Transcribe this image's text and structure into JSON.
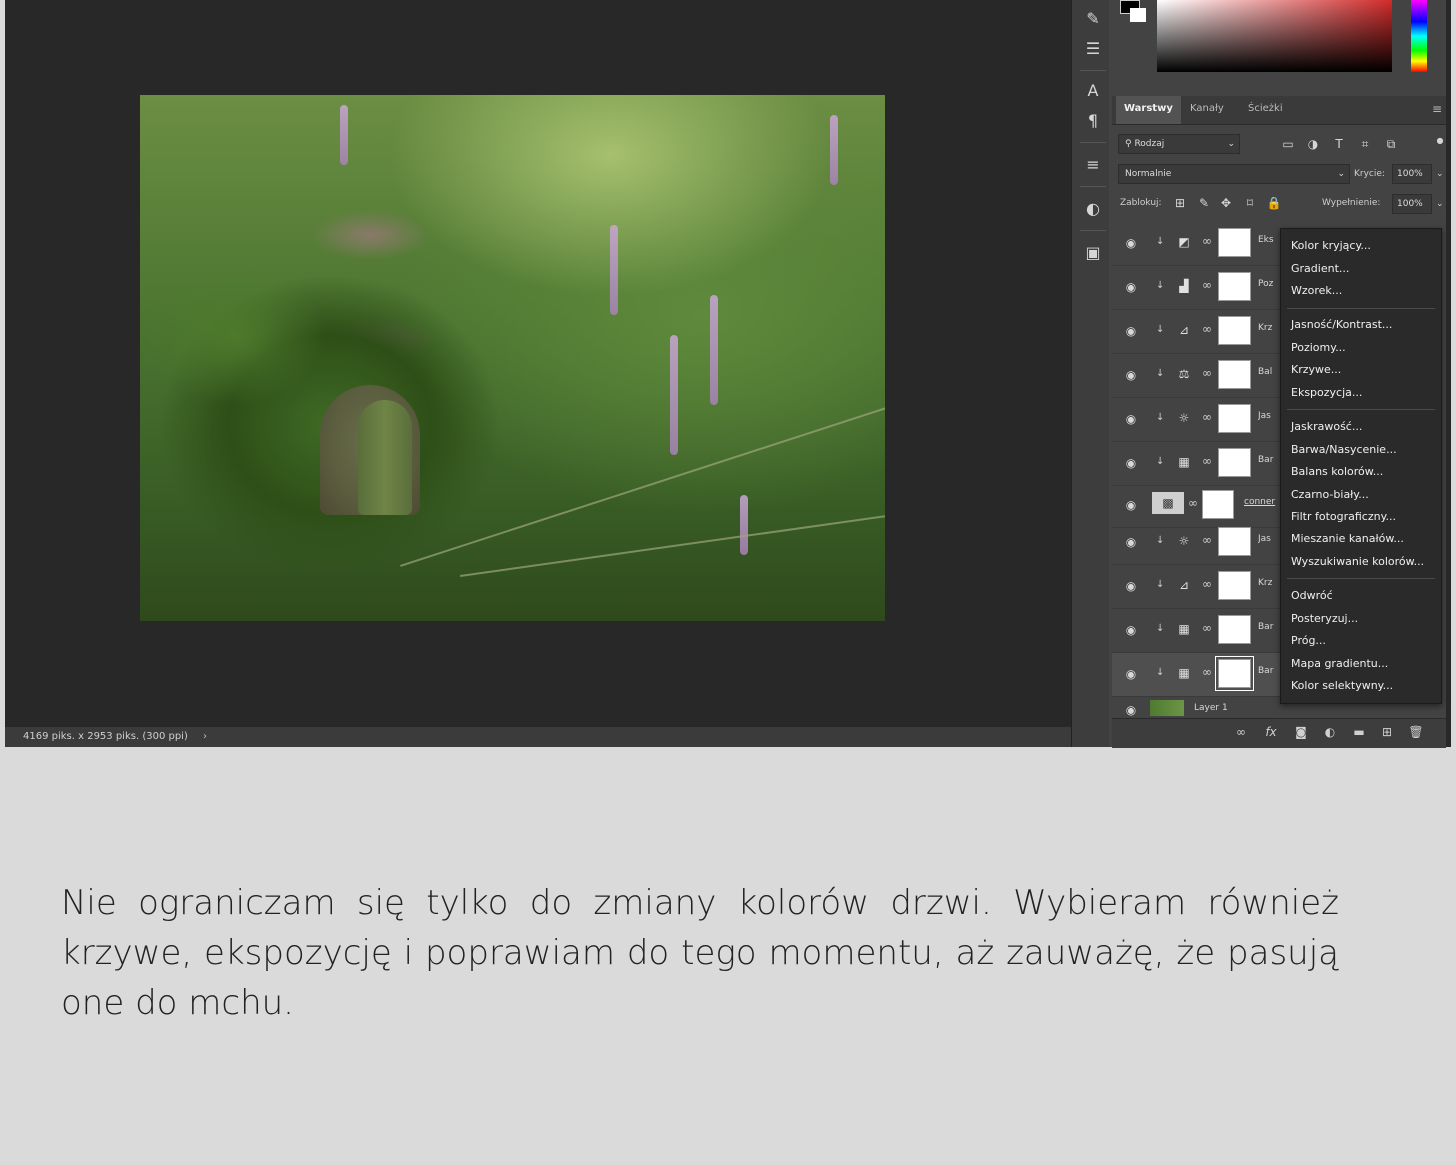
{
  "statusbar": {
    "dimensions": "4169 piks. x 2953 piks. (300 ppi)",
    "arrow": "›"
  },
  "panel": {
    "tabs": [
      "Warstwy",
      "Kanały",
      "Ścieżki"
    ],
    "filter": "Rodzaj",
    "blend_mode": "Normalnie",
    "opacity_label": "Krycie:",
    "opacity_value": "100%",
    "lock_label": "Zablokuj:",
    "fill_label": "Wypełnienie:",
    "fill_value": "100%"
  },
  "layers": [
    {
      "name": "Eks",
      "adj_icon": "exposure-icon"
    },
    {
      "name": "Poz",
      "adj_icon": "levels-icon"
    },
    {
      "name": "Krz",
      "adj_icon": "curves-icon"
    },
    {
      "name": "Bal",
      "adj_icon": "color-balance-icon"
    },
    {
      "name": "Jas",
      "adj_icon": "brightness-icon"
    },
    {
      "name": "Bar",
      "adj_icon": "hue-saturation-icon"
    },
    {
      "name": "conner",
      "adj_icon": "smart-object-icon"
    },
    {
      "name": "Jas",
      "adj_icon": "brightness-icon"
    },
    {
      "name": "Krz",
      "adj_icon": "curves-icon"
    },
    {
      "name": "Bar",
      "adj_icon": "hue-saturation-icon"
    },
    {
      "name": "Bar",
      "adj_icon": "hue-saturation-icon"
    },
    {
      "name": "Layer 1",
      "adj_icon": "image-thumbnail"
    }
  ],
  "menu": {
    "items": [
      "Kolor kryjący...",
      "Gradient...",
      "Wzorek...",
      "Jasność/Kontrast...",
      "Poziomy...",
      "Krzywe...",
      "Ekspozycja...",
      "Jaskrawość...",
      "Barwa/Nasycenie...",
      "Balans kolorów...",
      "Czarno-biały...",
      "Filtr fotograficzny...",
      "Mieszanie kanałów...",
      "Wyszukiwanie kolorów...",
      "Odwróć",
      "Posteryzuj...",
      "Próg...",
      "Mapa gradientu...",
      "Kolor selektywny..."
    ]
  },
  "caption": "Nie ograniczam się tylko do zmiany kolorów drzwi. Wybieram również krzywe, ekspozycję i poprawiam do tego momentu, aż zauważę, że pasują one do mchu.",
  "colors": {
    "app_bg": "#282828",
    "panel_bg": "#434343",
    "menu_bg": "#2a2a2a",
    "page_bg": "#dadada"
  }
}
